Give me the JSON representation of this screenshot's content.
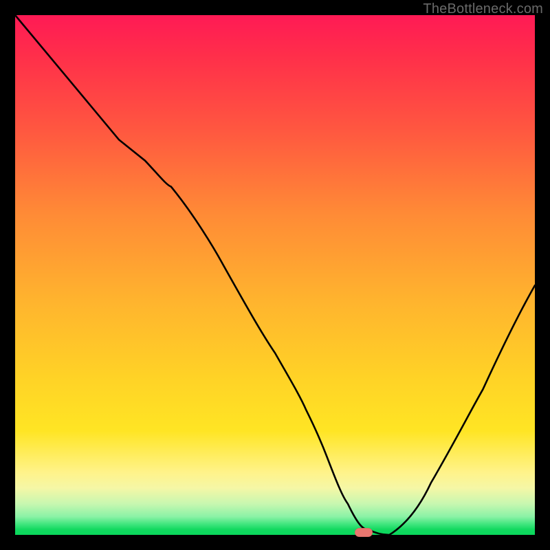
{
  "watermark": "TheBottleneck.com",
  "marker": {
    "color_hex": "#e9766f"
  },
  "chart_data": {
    "type": "line",
    "title": "",
    "xlabel": "",
    "ylabel": "",
    "xlim": [
      0,
      100
    ],
    "ylim": [
      0,
      100
    ],
    "grid": false,
    "legend": false,
    "gradient_stops": [
      {
        "pos": 0.0,
        "color": "#ff1a55"
      },
      {
        "pos": 0.22,
        "color": "#ff5740"
      },
      {
        "pos": 0.55,
        "color": "#ffb42e"
      },
      {
        "pos": 0.8,
        "color": "#ffe524"
      },
      {
        "pos": 0.91,
        "color": "#f5f7a6"
      },
      {
        "pos": 0.96,
        "color": "#8af2a6"
      },
      {
        "pos": 1.0,
        "color": "#0ad75c"
      }
    ],
    "series": [
      {
        "name": "bottleneck-curve",
        "x": [
          0,
          10,
          20,
          25,
          30,
          40,
          50,
          56,
          60,
          64,
          68,
          72,
          80,
          90,
          100
        ],
        "y": [
          100,
          88,
          76,
          72,
          67,
          52,
          35,
          24,
          15,
          6,
          1,
          0,
          10,
          28,
          48
        ]
      }
    ],
    "marker_point": {
      "x": 67,
      "y": 0
    }
  }
}
